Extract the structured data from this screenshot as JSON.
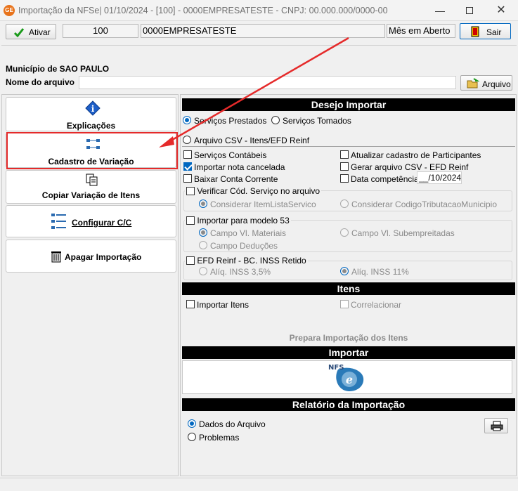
{
  "window": {
    "title": "Importação da NFSe| 01/10/2024 - [100] - 0000EMPRESATESTE - CNPJ: 00.000.000/0000-00",
    "app_icon": "GE"
  },
  "toolbar": {
    "ativar_label": "Ativar",
    "company_code": "100",
    "company_name": "0000EMPRESATESTE",
    "period_status": "Mês em Aberto",
    "sair_label": "Sair"
  },
  "file": {
    "municipality": "Município de SAO PAULO",
    "filename_label": "Nome do arquivo",
    "filename_value": "",
    "arquivo_button": "Arquivo"
  },
  "menu": {
    "explicacoes": "Explicações",
    "cadastro_variacao": "Cadastro de Variação",
    "copiar_variacao": "Copiar Variação de Itens",
    "configurar_cc": "Configurar C/C",
    "apagar_importacao": "Apagar Importação"
  },
  "desejo": {
    "header": "Desejo Importar",
    "servicos_prestados": "Serviços Prestados",
    "servicos_tomados": "Serviços Tomados",
    "arquivo_csv": "Arquivo CSV - Itens/EFD Reinf",
    "servicos_contabeis": "Serviços Contábeis",
    "atualizar_participantes": "Atualizar cadastro de Participantes",
    "importar_cancelada": "Importar nota cancelada",
    "gerar_csv": "Gerar arquivo CSV - EFD Reinf",
    "baixar_conta": "Baixar Conta Corrente",
    "data_competencia": "Data competência",
    "data_competencia_value": "__/10/2024",
    "verificar_cod": "Verificar Cód. Serviço no arquivo",
    "considerar_item": "Considerar ItemListaServico",
    "considerar_codigo": "Considerar CodigoTributacaoMunicipio",
    "modelo53": "Importar para modelo 53",
    "campo_materiais": "Campo Vl. Materiais",
    "campo_subempreitadas": "Campo Vl. Subempreitadas",
    "campo_deducoes": "Campo Deduções",
    "efd_reinf": "EFD Reinf - BC. INSS Retido",
    "aliq_35": "Alíq. INSS 3,5%",
    "aliq_11": "Alíq. INSS 11%"
  },
  "itens": {
    "header": "Itens",
    "importar_itens": "Importar Itens",
    "correlacionar": "Correlacionar",
    "prepara": "Prepara Importação dos Itens"
  },
  "importar": {
    "header": "Importar",
    "nfse_logo_text": "NFS"
  },
  "relatorio": {
    "header": "Relatório da Importação",
    "dados_arquivo": "Dados do Arquivo",
    "problemas": "Problemas"
  },
  "annotation": {
    "highlight_color": "#e52a2a"
  }
}
